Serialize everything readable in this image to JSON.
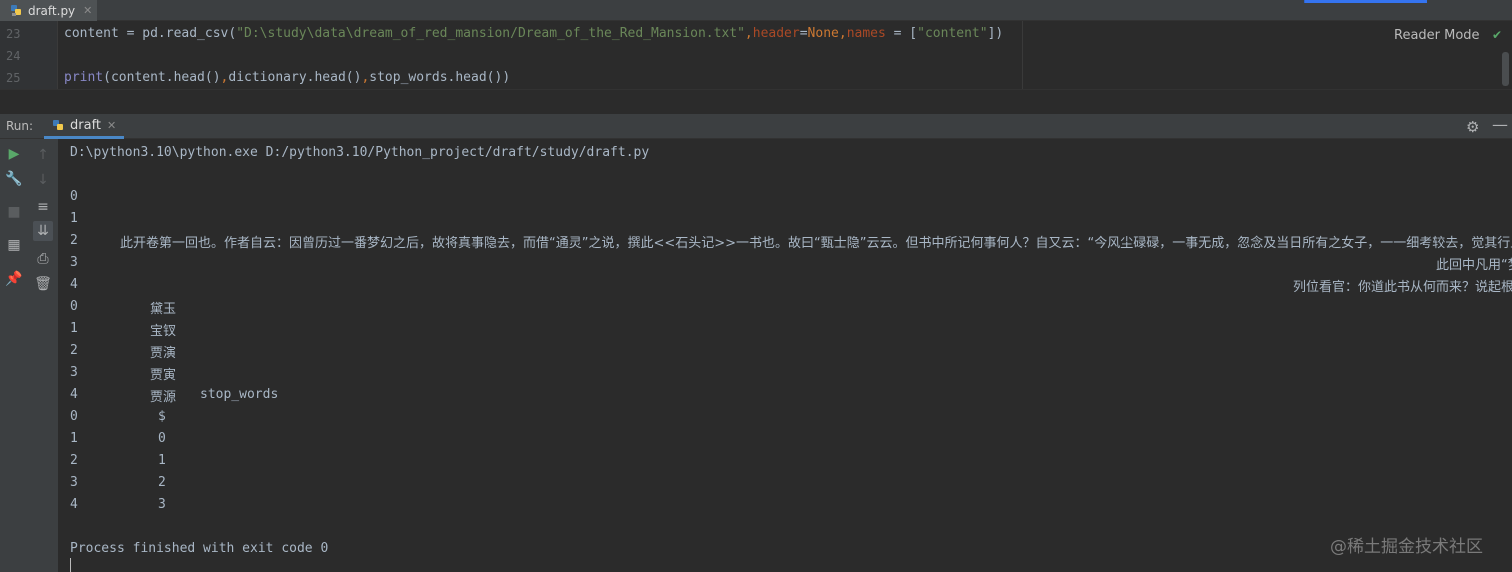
{
  "tab": {
    "filename": "draft.py"
  },
  "editor": {
    "line_numbers": [
      "23",
      "24",
      "25"
    ],
    "line23": {
      "a": "content = pd.read_csv(",
      "path": "\"D:\\study\\data\\dream_of_red_mansion/Dream_of_the_Red_Mansion.txt\"",
      "comma1": ",",
      "p1": "header",
      "eq1": "=",
      "none": "None",
      "comma2": ",",
      "p2": "names",
      "eq2": " = [",
      "s2": "\"content\"",
      "end": "])"
    },
    "line25": {
      "print": "print",
      "a": "(content.head()",
      "c1": ",",
      "b": "dictionary.head()",
      "c2": ",",
      "d": "stop_words.head())"
    },
    "reader_mode": "Reader Mode"
  },
  "run": {
    "label": "Run:",
    "tab": "draft"
  },
  "console": {
    "cmd": "D:\\python3.10\\python.exe D:/python3.10/Python_project/draft/study/draft.py",
    "block1_idx": [
      "0",
      "1",
      "2",
      "3",
      "4"
    ],
    "row2_text": "此开卷第一回也。作者自云：因曾历过一番梦幻之后，故将真事隐去，而借“通灵”之说，撰此<<石头记>>一书也。故曰“甄士隐”云云。但书中所记何事何人？自又云：“今风尘碌碌，一事无成，忽念及当日所有之女子，一一细考较去，觉其行止见识",
    "row3_text": "此回中凡用“梦",
    "row4_text": "列位看官：你道此书从何而来？说起根由",
    "block2": [
      {
        "idx": "0",
        "val": "黛玉"
      },
      {
        "idx": "1",
        "val": "宝钗"
      },
      {
        "idx": "2",
        "val": "贾演"
      },
      {
        "idx": "3",
        "val": "贾寅"
      },
      {
        "idx": "4",
        "val": "贾源"
      }
    ],
    "stop_words_header": "stop_words",
    "block3": [
      {
        "idx": "0",
        "val": "$"
      },
      {
        "idx": "1",
        "val": "0"
      },
      {
        "idx": "2",
        "val": "1"
      },
      {
        "idx": "3",
        "val": "2"
      },
      {
        "idx": "4",
        "val": "3"
      }
    ],
    "finish": "Process finished with exit code 0"
  },
  "watermark": "@稀土掘金技术社区",
  "colors": {
    "keyword": "#cc7832",
    "string": "#6a8759",
    "param": "#aa4926",
    "builtin": "#8888c6",
    "accent": "#3574f0"
  }
}
